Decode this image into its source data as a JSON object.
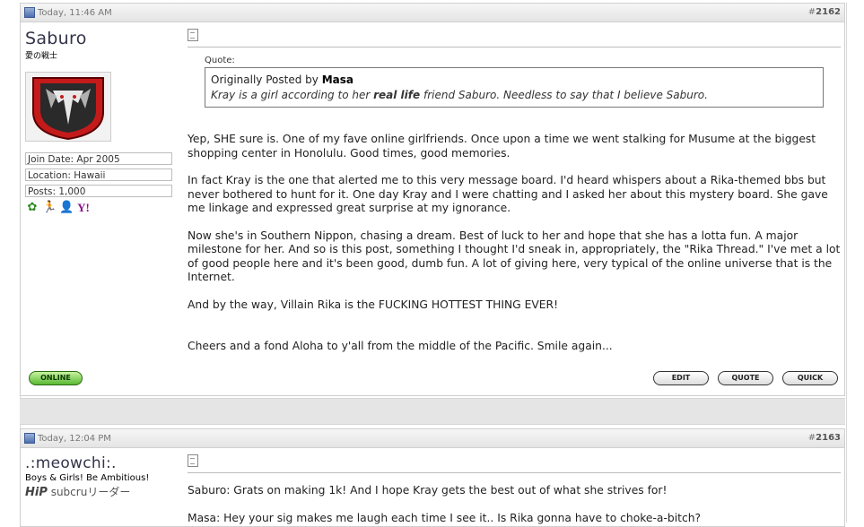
{
  "posts": [
    {
      "date": "Today, 11:46 AM",
      "number_prefix": "#",
      "number": "2162",
      "username": "Saburo",
      "user_title": "愛の戦士",
      "info": {
        "join_date": "Join Date: Apr 2005",
        "location": "Location: Hawaii",
        "posts": "Posts: 1,000"
      },
      "icons": [
        "dollar-icon",
        "runner-icon",
        "person-icon",
        "yahoo-icon"
      ],
      "quote_label": "Quote:",
      "quote_prefix": "Originally Posted by",
      "quote_author": "Masa",
      "quote_text_a": "Kray is a girl according to her",
      "quote_text_bold": "real life",
      "quote_text_b": "friend Saburo. Needless to say that I believe Saburo.",
      "paragraphs": [
        "Yep, SHE sure is. One of my fave online girlfriends. Once upon a time we went stalking for Musume at the biggest shopping center in Honolulu. Good times, good memories.",
        "In fact Kray is the one that alerted me to this very message board. I'd heard whispers about a Rika-themed bbs but never bothered to hunt for it. One day Kray and I were chatting and I asked her about this mystery board. She gave me linkage and expressed great surprise at my ignorance.",
        "Now she's in Southern Nippon, chasing a dream. Best of luck to her and hope that she has a lotta fun. A major milestone for her. And so is this post, something I thought I'd sneak in, appropriately, the \"Rika Thread.\" I've met a lot of good people here and it's been good, dumb fun. A lot of giving here, very typical of the online universe that is the Internet.",
        "And by the way, Villain Rika is the FUCKING HOTTEST THING EVER!",
        "Cheers and a fond Aloha to y'all from the middle of the Pacific. Smile again..."
      ],
      "buttons": {
        "online": "ONLINE",
        "edit": "EDIT",
        "quote": "QUOTE",
        "quick": "QUICK"
      }
    },
    {
      "date": "Today, 12:04 PM",
      "number_prefix": "#",
      "number": "2163",
      "username": ".:meowchi:.",
      "user_title": "Boys & Girls! Be Ambitious!",
      "logo_text": "HiP",
      "logo_sub": "subcruリーダー",
      "paragraphs": [
        "Saburo: Grats on making 1k! And I hope Kray gets the best out of what she strives for!",
        "Masa: Hey your sig makes me laugh each time I see it.. Is Rika gonna have to choke-a-bitch?"
      ]
    }
  ],
  "colors": {
    "online_green": "#58b832",
    "header_bg": "#e4e4e4"
  }
}
